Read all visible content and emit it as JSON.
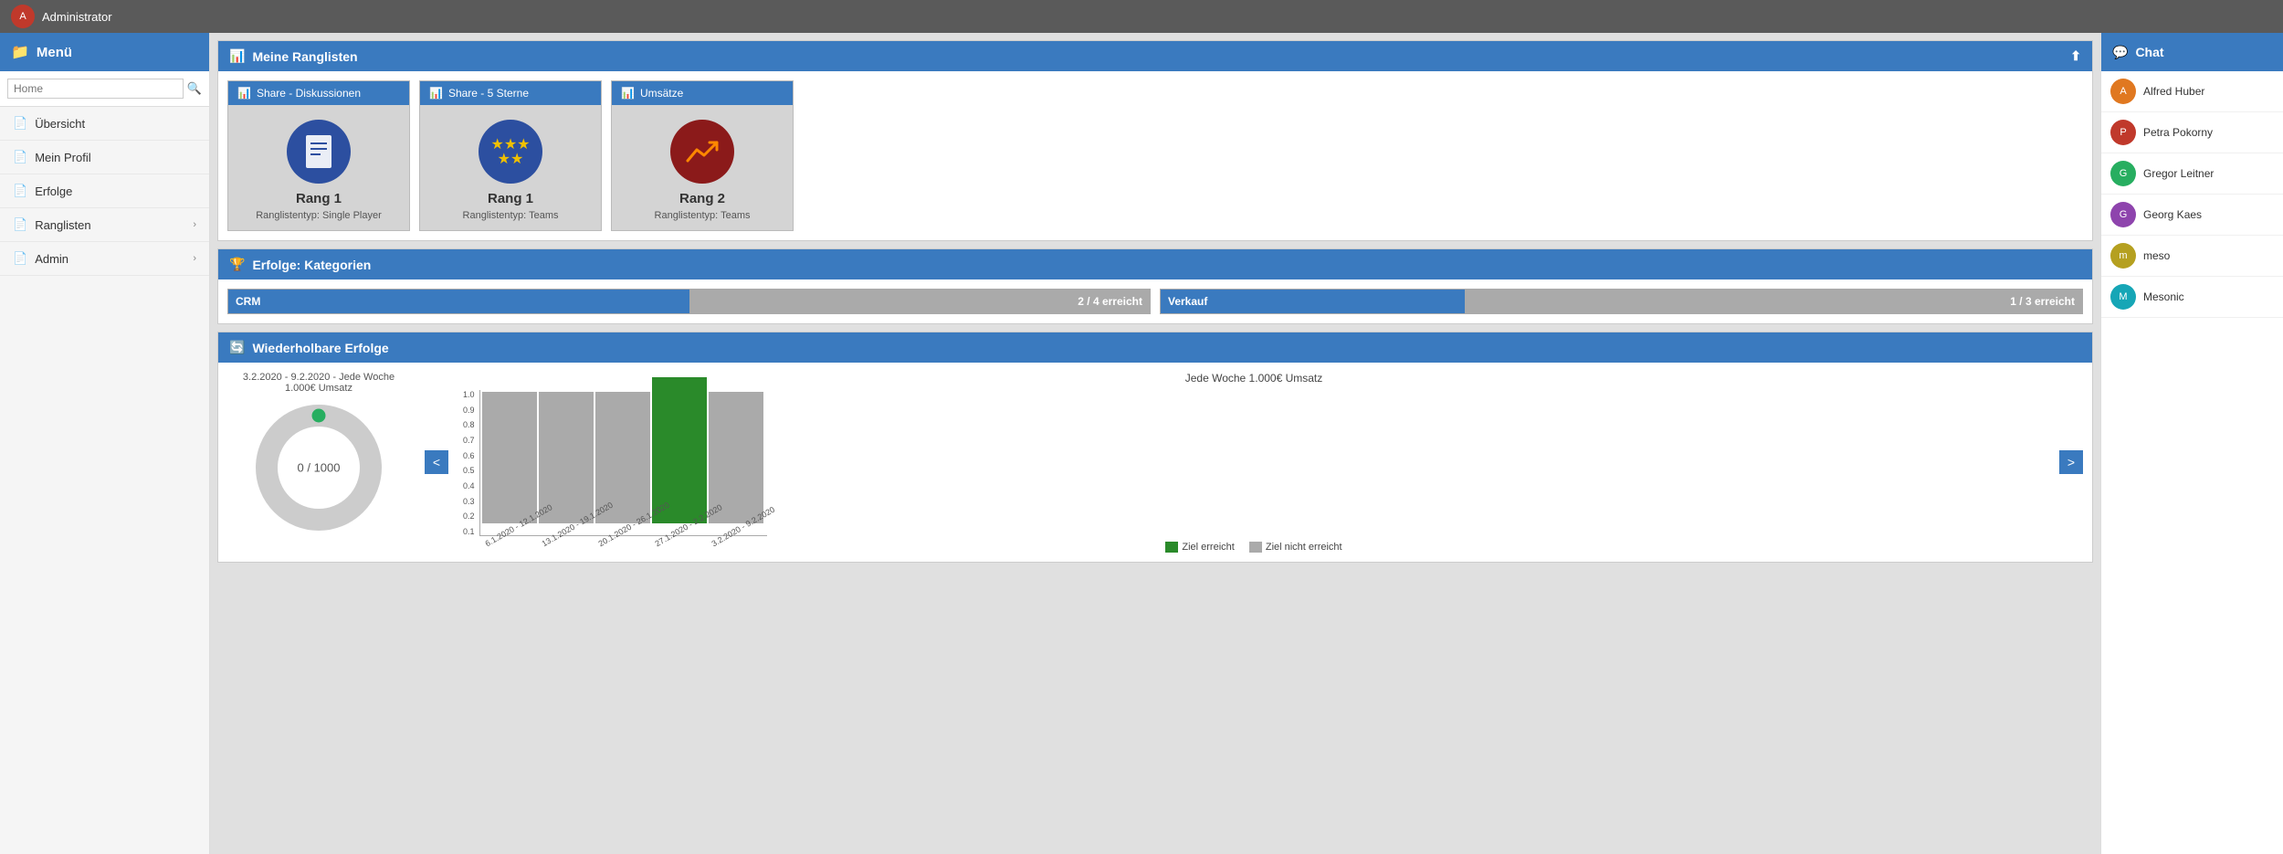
{
  "topbar": {
    "username": "Administrator"
  },
  "sidebar": {
    "title": "Menü",
    "search_placeholder": "Home",
    "items": [
      {
        "label": "Übersicht",
        "has_chevron": false
      },
      {
        "label": "Mein Profil",
        "has_chevron": false
      },
      {
        "label": "Erfolge",
        "has_chevron": false
      },
      {
        "label": "Ranglisten",
        "has_chevron": true
      },
      {
        "label": "Admin",
        "has_chevron": true
      }
    ]
  },
  "ranglisten": {
    "title": "Meine Ranglisten",
    "cards": [
      {
        "title": "Share - Diskussionen",
        "icon_type": "document",
        "rank_label": "Rang 1",
        "subtext": "Ranglistentyp: Single Player"
      },
      {
        "title": "Share - 5 Sterne",
        "icon_type": "stars",
        "rank_label": "Rang 1",
        "subtext": "Ranglistentyp: Teams"
      },
      {
        "title": "Umsätze",
        "icon_type": "chart",
        "rank_label": "Rang 2",
        "subtext": "Ranglistentyp: Teams"
      }
    ]
  },
  "erfolge": {
    "title": "Erfolge: Kategorien",
    "bars": [
      {
        "label": "CRM",
        "filled_pct": 50,
        "status": "2 / 4 erreicht"
      },
      {
        "label": "Verkauf",
        "filled_pct": 33,
        "status": "1 / 3 erreicht"
      }
    ]
  },
  "wiederholbare": {
    "title": "Wiederholbare Erfolge",
    "donut_title": "3.2.2020 - 9.2.2020 - Jede Woche 1.000€ Umsatz",
    "donut_value": "0 / 1000",
    "chart_title": "Jede Woche 1.000€ Umsatz",
    "bars": [
      {
        "label": "6.1.2020 - 12.1.2020",
        "value": 0.9,
        "achieved": false
      },
      {
        "label": "13.1.2020 - 19.1.2020",
        "value": 0.9,
        "achieved": false
      },
      {
        "label": "20.1.2020 - 26.1.2020",
        "value": 0.9,
        "achieved": false
      },
      {
        "label": "27.1.2020 - 2.2.2020",
        "value": 1.0,
        "achieved": true
      },
      {
        "label": "3.2.2020 - 9.2.2020",
        "value": 0.9,
        "achieved": false
      }
    ],
    "y_labels": [
      "1.0",
      "0.9",
      "0.8",
      "0.7",
      "0.6",
      "0.5",
      "0.4",
      "0.3",
      "0.2",
      "0.1"
    ],
    "legend": [
      {
        "label": "Ziel erreicht",
        "color": "#2a8a2a"
      },
      {
        "label": "Ziel nicht erreicht",
        "color": "#aaaaaa"
      }
    ],
    "nav_prev": "<",
    "nav_next": ">"
  },
  "chat": {
    "title": "Chat",
    "users": [
      {
        "name": "Alfred Huber",
        "color": "#e07820"
      },
      {
        "name": "Petra Pokorny",
        "color": "#c0392b"
      },
      {
        "name": "Gregor Leitner",
        "color": "#27ae60"
      },
      {
        "name": "Georg Kaes",
        "color": "#8e44ad"
      },
      {
        "name": "meso",
        "color": "#b5a020"
      },
      {
        "name": "Mesonic",
        "color": "#16a6b6"
      }
    ]
  }
}
